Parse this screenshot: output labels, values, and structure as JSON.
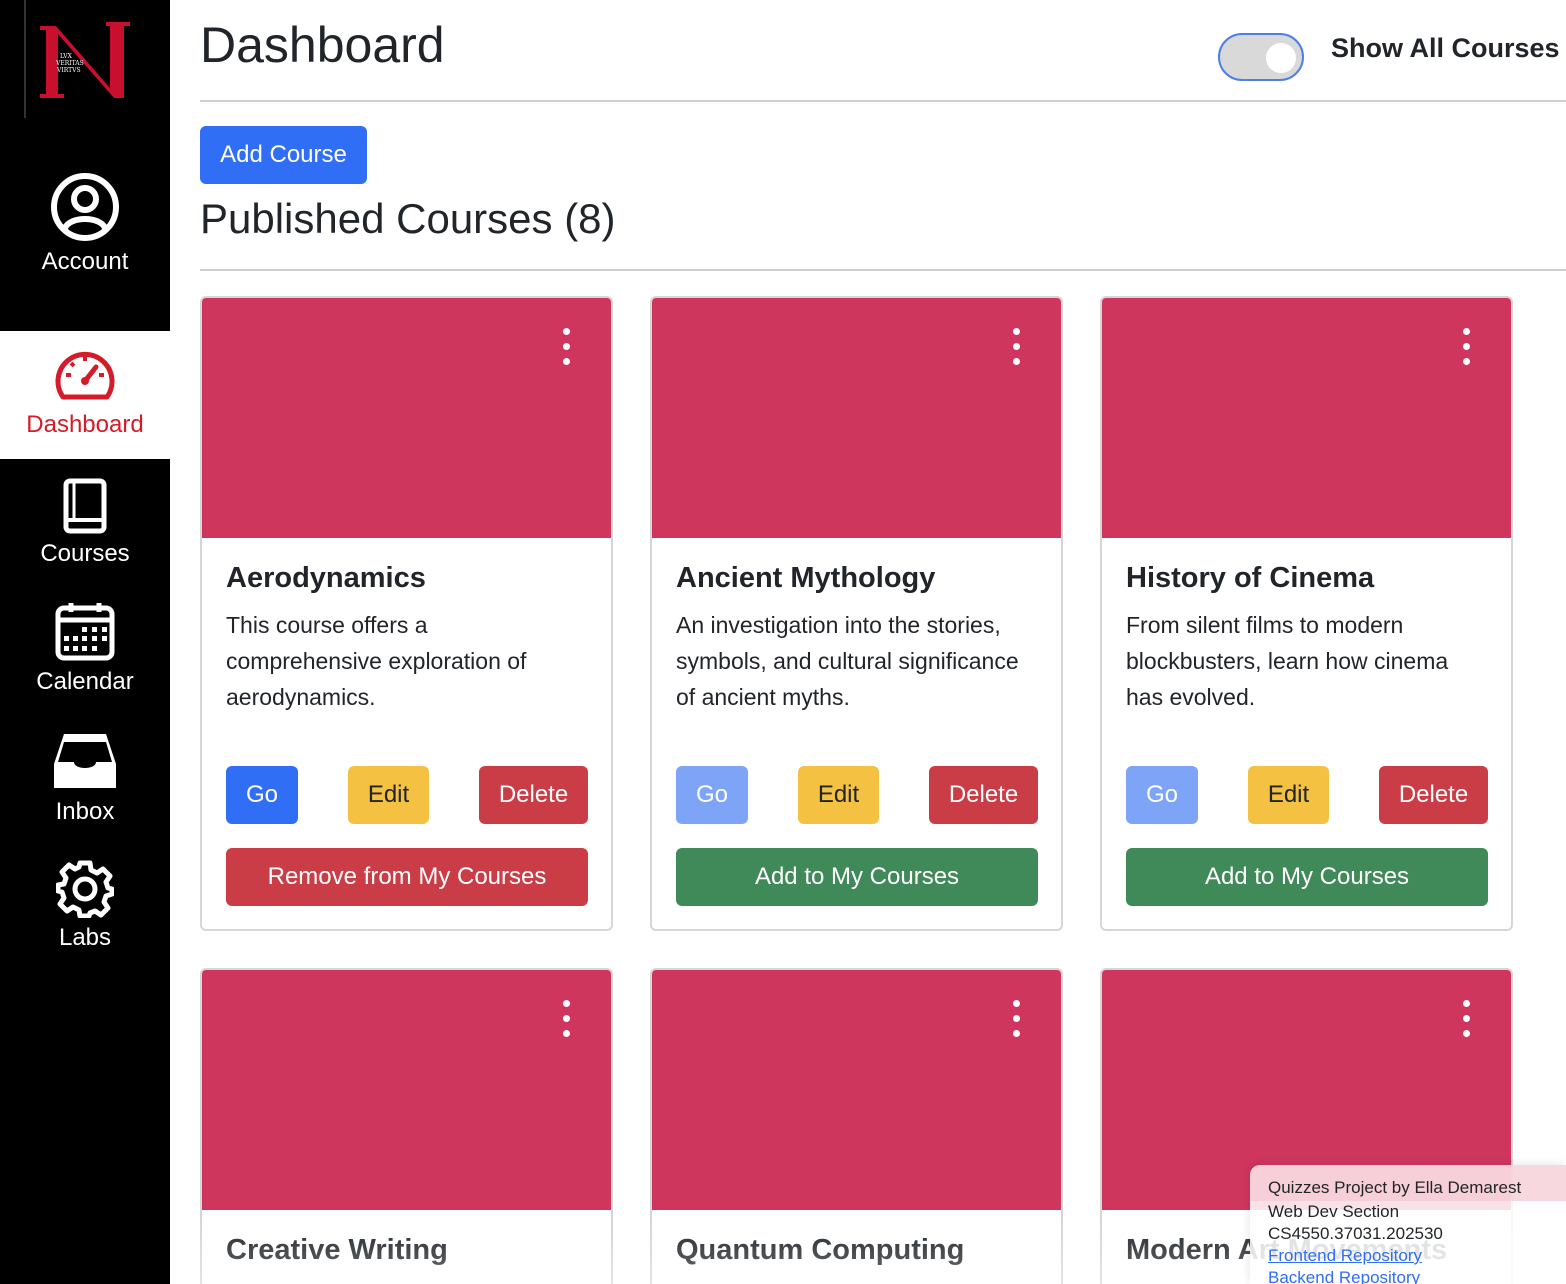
{
  "sidebar": {
    "logo": {
      "alt": "Northeastern",
      "motto": "LVX VERITAS VIRTVS"
    },
    "items": [
      {
        "label": "Account",
        "icon": "account-circle-icon"
      },
      {
        "label": "Dashboard",
        "icon": "speedometer-icon",
        "active": true
      },
      {
        "label": "Courses",
        "icon": "book-icon"
      },
      {
        "label": "Calendar",
        "icon": "calendar-icon"
      },
      {
        "label": "Inbox",
        "icon": "inbox-icon"
      },
      {
        "label": "Labs",
        "icon": "gear-icon"
      }
    ]
  },
  "header": {
    "title": "Dashboard",
    "toggle_label": "Show All Courses",
    "toggle_on": false
  },
  "toolbar": {
    "add_course_label": "Add Course"
  },
  "section": {
    "title": "Published Courses (8)"
  },
  "colors": {
    "accent": "#d51a2a",
    "banner": "#cf365e",
    "primary": "#2f6ef5",
    "warning": "#f5c142",
    "danger": "#cb3d46",
    "success": "#3f8a58"
  },
  "courses": [
    {
      "title": "Aerodynamics",
      "description": "This course offers a comprehensive exploration of aerodynamics.",
      "go": "Go",
      "edit": "Edit",
      "delete": "Delete",
      "action": "Remove from My Courses"
    },
    {
      "title": "Ancient Mythology",
      "description": "An investigation into the stories, symbols, and cultural significance of ancient myths.",
      "go": "Go",
      "edit": "Edit",
      "delete": "Delete",
      "action": "Add to My Courses"
    },
    {
      "title": "History of Cinema",
      "description": "From silent films to modern blockbusters, learn how cinema has evolved.",
      "go": "Go",
      "edit": "Edit",
      "delete": "Delete",
      "action": "Add to My Courses"
    },
    {
      "title": "Creative Writing"
    },
    {
      "title": "Quantum Computing"
    },
    {
      "title": "Modern Art Movements"
    }
  ],
  "footer": {
    "line1": "Quizzes Project by Ella Demarest",
    "line2": "Web Dev Section",
    "line3": "CS4550.37031.202530",
    "frontend_link": "Frontend Repository",
    "backend_link": "Backend Repository"
  }
}
